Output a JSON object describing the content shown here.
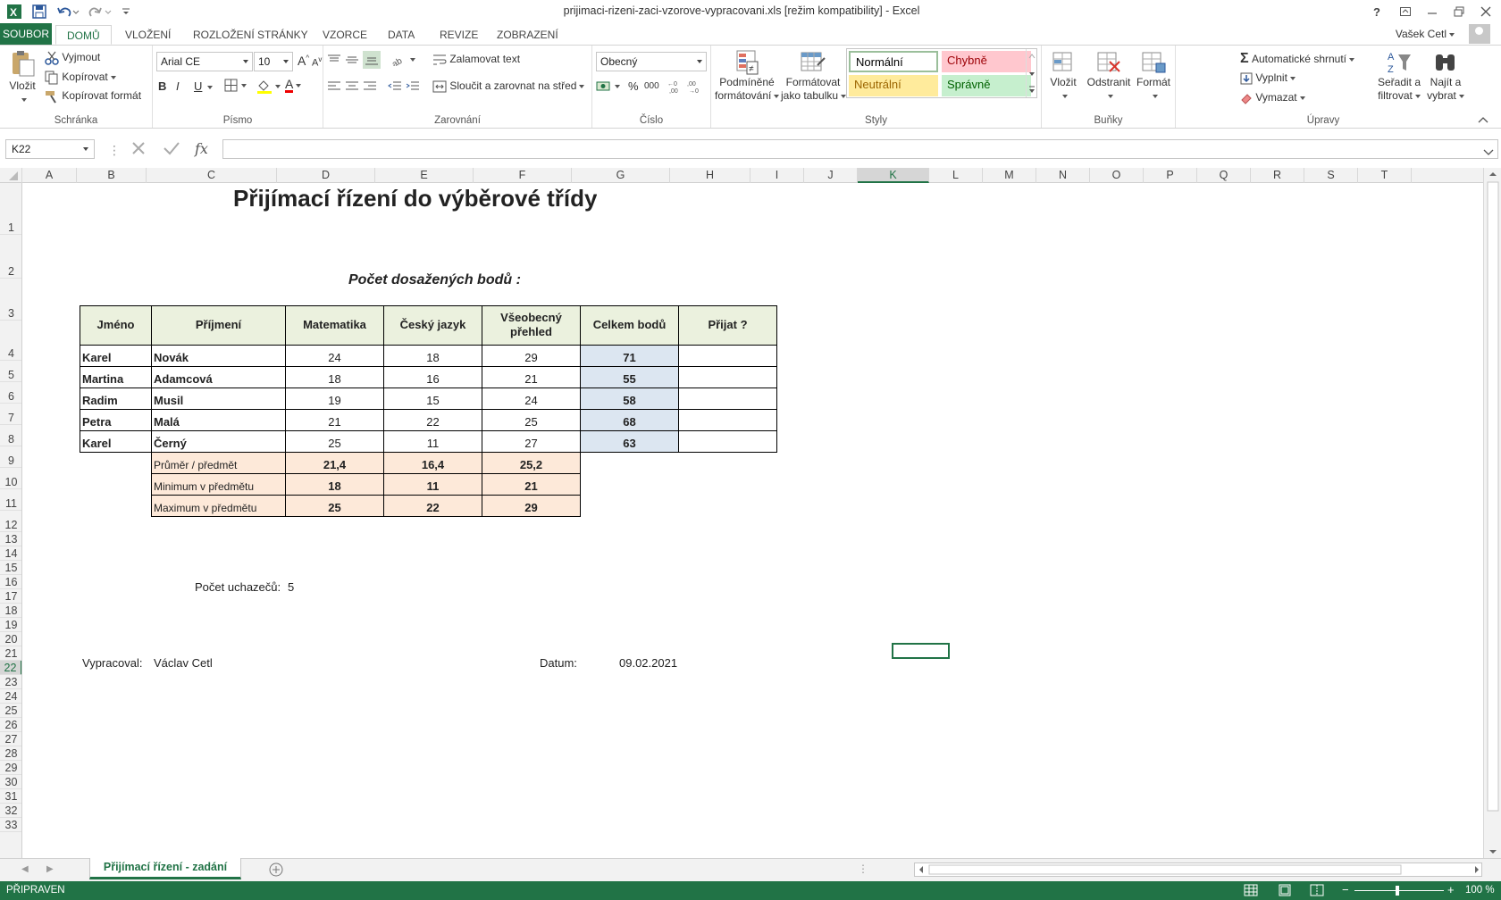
{
  "window": {
    "title": "prijimaci-rizeni-zaci-vzorove-vypracovani.xls  [režim kompatibility] - Excel",
    "help": "?"
  },
  "tabs": {
    "file": "SOUBOR",
    "items": [
      "DOMŮ",
      "VLOŽENÍ",
      "ROZLOŽENÍ STRÁNKY",
      "VZORCE",
      "DATA",
      "REVIZE",
      "ZOBRAZENÍ"
    ],
    "active": "DOMŮ"
  },
  "user": {
    "name": "Vašek Cetl"
  },
  "ribbon": {
    "clipboard": {
      "label": "Schránka",
      "paste": "Vložit",
      "cut": "Vyjmout",
      "copy": "Kopírovat",
      "format_painter": "Kopírovat formát"
    },
    "font": {
      "label": "Písmo",
      "name": "Arial CE",
      "size": "10",
      "bold": "B",
      "italic": "I",
      "underline": "U",
      "color_letter": "A"
    },
    "alignment": {
      "label": "Zarovnání",
      "wrap": "Zalamovat text",
      "merge": "Sloučit a zarovnat na střed"
    },
    "number": {
      "label": "Číslo",
      "format": "Obecný",
      "percent": "%",
      "thousands": "000"
    },
    "styles": {
      "label": "Styly",
      "conditional": [
        "Podmíněné",
        "formátování"
      ],
      "as_table": [
        "Formátovat",
        "jako tabulku"
      ],
      "normal": "Normální",
      "bad": "Chybně",
      "neutral": "Neutrální",
      "good": "Správně"
    },
    "cells": {
      "label": "Buňky",
      "insert": "Vložit",
      "delete": "Odstranit",
      "format": "Formát"
    },
    "editing": {
      "label": "Úpravy",
      "autosum": "Automatické shrnutí",
      "fill": "Vyplnit",
      "clear": "Vymazat",
      "sort": [
        "Seřadit a",
        "filtrovat"
      ],
      "find": [
        "Najít a",
        "vybrat"
      ]
    }
  },
  "formula_bar": {
    "name_box": "K22",
    "fx": "fx",
    "value": ""
  },
  "columns": [
    "A",
    "B",
    "C",
    "D",
    "E",
    "F",
    "G",
    "H",
    "I",
    "J",
    "K",
    "L",
    "M",
    "N",
    "O",
    "P",
    "Q",
    "R",
    "S",
    "T"
  ],
  "selected_column": "K",
  "rows": [
    "1",
    "2",
    "3",
    "4",
    "5",
    "6",
    "7",
    "8",
    "9",
    "10",
    "11",
    "12",
    "13",
    "14",
    "15",
    "16",
    "17",
    "18",
    "19",
    "20",
    "21",
    "22",
    "23",
    "24",
    "25",
    "26",
    "27",
    "28",
    "29",
    "30",
    "31",
    "32",
    "33"
  ],
  "selected_row": "22",
  "sheet": {
    "title": "Přijímací řízení do výběrové třídy",
    "subtitle": "Počet dosažených bodů :",
    "headers": [
      "Jméno",
      "Příjmení",
      "Matematika",
      "Český jazyk",
      "Všeobecný přehled",
      "Celkem bodů",
      "Přijat ?"
    ],
    "students": [
      {
        "first": "Karel",
        "last": "Novák",
        "math": "24",
        "czech": "18",
        "general": "29",
        "total": "71",
        "admitted": ""
      },
      {
        "first": "Martina",
        "last": "Adamcová",
        "math": "18",
        "czech": "16",
        "general": "21",
        "total": "55",
        "admitted": ""
      },
      {
        "first": "Radim",
        "last": "Musil",
        "math": "19",
        "czech": "15",
        "general": "24",
        "total": "58",
        "admitted": ""
      },
      {
        "first": "Petra",
        "last": "Malá",
        "math": "21",
        "czech": "22",
        "general": "25",
        "total": "68",
        "admitted": ""
      },
      {
        "first": "Karel",
        "last": "Černý",
        "math": "25",
        "czech": "11",
        "general": "27",
        "total": "63",
        "admitted": ""
      }
    ],
    "stats": [
      {
        "label": "Průměr / předmět",
        "math": "21,4",
        "czech": "16,4",
        "general": "25,2"
      },
      {
        "label": "Minimum v předmětu",
        "math": "18",
        "czech": "11",
        "general": "21"
      },
      {
        "label": "Maximum v předmětu",
        "math": "25",
        "czech": "22",
        "general": "29"
      }
    ],
    "applicants_label": "Počet uchazečů:",
    "applicants_count": "5",
    "prepared_by_label": "Vypracoval:",
    "prepared_by": "Václav Cetl",
    "date_label": "Datum:",
    "date": "09.02.2021"
  },
  "sheet_tab": "Přijímací řízení - zadání",
  "status": {
    "ready": "PŘIPRAVEN",
    "zoom": "100 %"
  },
  "colors": {
    "accent": "#217346",
    "header_fill": "#ebf1de",
    "total_fill": "#dce6f1",
    "stats_fill": "#fde9d9"
  }
}
